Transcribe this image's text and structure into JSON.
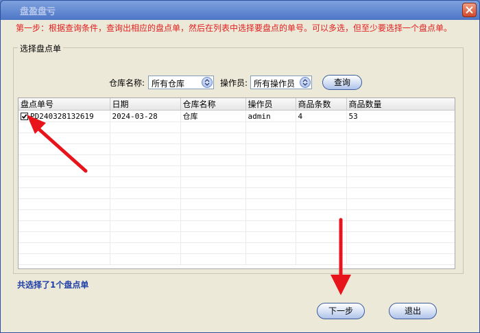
{
  "window": {
    "title": "盘盈盘亏"
  },
  "instruction": "第一步：根据查询条件，查询出相应的盘点单，然后在列表中选择要盘点的单号。可以多选，但至少要选择一个盘点单。",
  "group": {
    "label": "选择盘点单"
  },
  "filters": {
    "warehouse_label": "仓库名称:",
    "warehouse_value": "所有仓库",
    "operator_label": "操作员:",
    "operator_value": "所有操作员",
    "query_button": "查询"
  },
  "table": {
    "columns": [
      "盘点单号",
      "日期",
      "仓库名称",
      "操作员",
      "商品条数",
      "商品数量"
    ],
    "rows": [
      {
        "checked": true,
        "order_no": "PD240328132619",
        "date": "2024-03-28",
        "warehouse": "仓库",
        "operator": "admin",
        "item_count": "4",
        "quantity": "53"
      }
    ]
  },
  "summary": "共选择了1个盘点单",
  "buttons": {
    "next": "下一步",
    "exit": "退出"
  },
  "colors": {
    "instruction": "#e02020",
    "summary": "#1f3fa8",
    "annotation_arrow": "#e8141c"
  }
}
